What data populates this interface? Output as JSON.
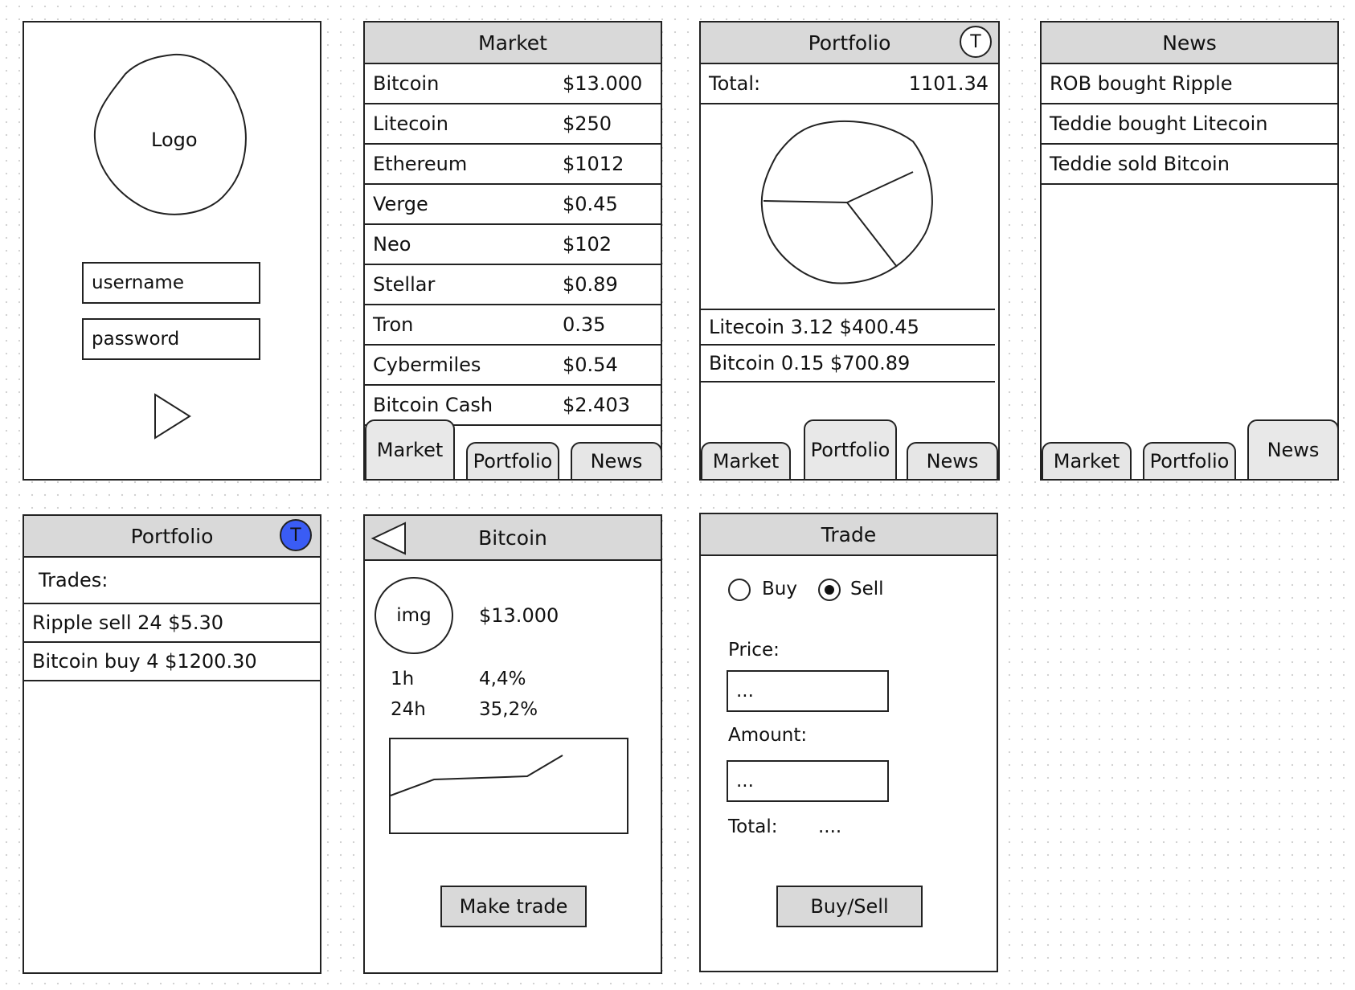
{
  "login": {
    "logo_label": "Logo",
    "username_placeholder": "username",
    "password_placeholder": "password"
  },
  "market": {
    "title": "Market",
    "rows": [
      {
        "name": "Bitcoin",
        "price": "$13.000"
      },
      {
        "name": "Litecoin",
        "price": "$250"
      },
      {
        "name": "Ethereum",
        "price": "$1012"
      },
      {
        "name": "Verge",
        "price": "$0.45"
      },
      {
        "name": "Neo",
        "price": "$102"
      },
      {
        "name": "Stellar",
        "price": "$0.89"
      },
      {
        "name": "Tron",
        "price": "0.35"
      },
      {
        "name": "Cybermiles",
        "price": "$0.54"
      },
      {
        "name": "Bitcoin Cash",
        "price": "$2.403"
      }
    ]
  },
  "tabs": {
    "market": "Market",
    "portfolio": "Portfolio",
    "news": "News"
  },
  "portfolio": {
    "title": "Portfolio",
    "avatar": "T",
    "total_label": "Total:",
    "total_value": "1101.34",
    "holdings": [
      "Litecoin 3.12 $400.45",
      "Bitcoin 0.15 $700.89"
    ]
  },
  "news": {
    "title": "News",
    "items": [
      "ROB bought Ripple",
      "Teddie bought Litecoin",
      "Teddie sold Bitcoin"
    ]
  },
  "portfolio_trades": {
    "title": "Portfolio",
    "avatar": "T",
    "avatar_color": "#3a5cf5",
    "trades_label": "Trades:",
    "trades": [
      "Ripple sell 24 $5.30",
      "Bitcoin buy 4 $1200.30"
    ]
  },
  "coin_detail": {
    "title": "Bitcoin",
    "img_label": "img",
    "price": "$13.000",
    "change_1h_label": "1h",
    "change_1h": "4,4%",
    "change_24h_label": "24h",
    "change_24h": "35,2%",
    "make_trade": "Make trade"
  },
  "trade": {
    "title": "Trade",
    "buy_label": "Buy",
    "sell_label": "Sell",
    "selected": "sell",
    "price_label": "Price:",
    "price_value": "...",
    "amount_label": "Amount:",
    "amount_value": "...",
    "total_label": "Total:",
    "total_value": "....",
    "submit": "Buy/Sell"
  },
  "icons": {
    "play": "play-icon",
    "back": "back-arrow-icon",
    "avatar": "avatar-icon"
  }
}
